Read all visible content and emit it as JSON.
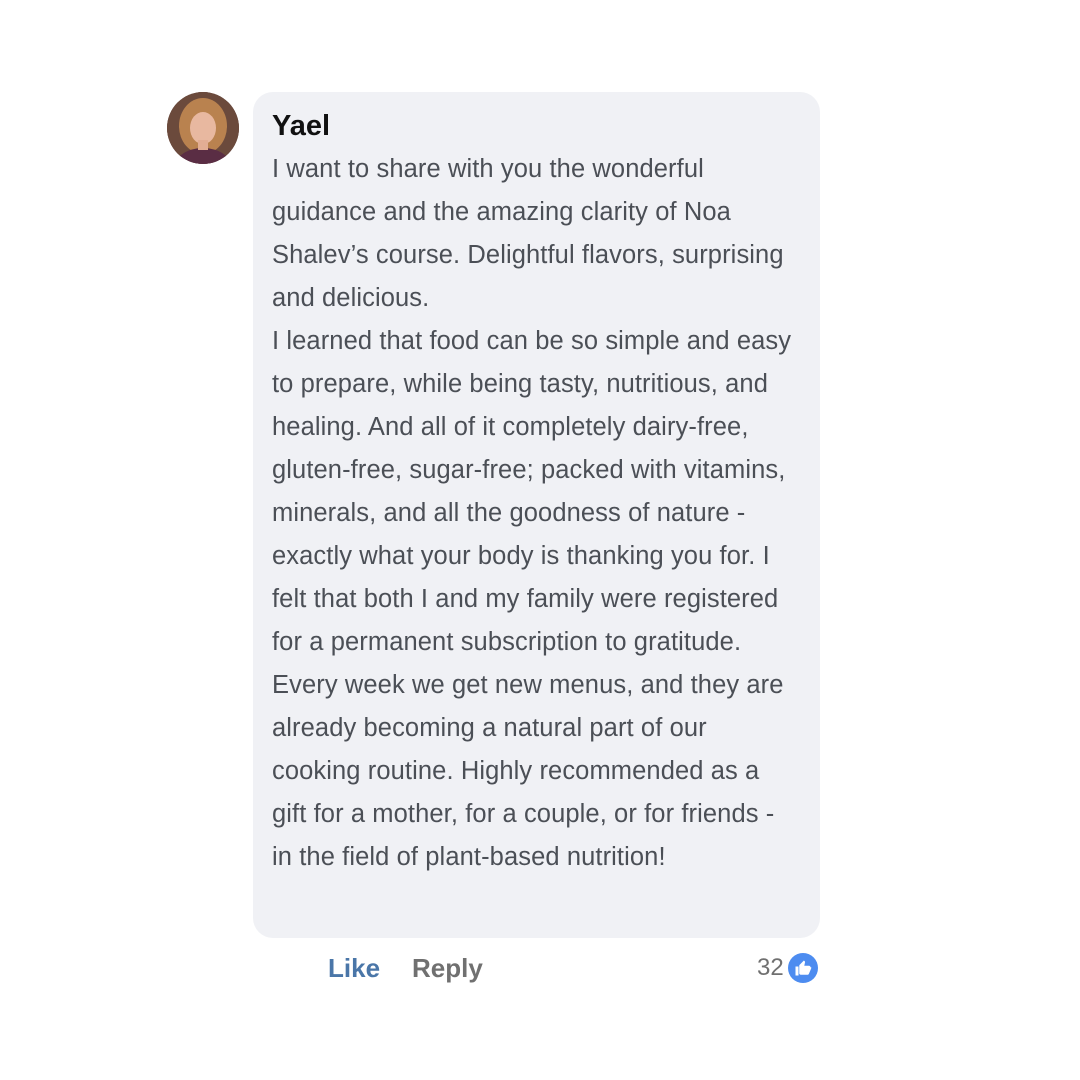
{
  "comment": {
    "author": "Yael",
    "paragraphs": [
      "I want to share with you the wonderful guidance and the amazing clarity of Noa Shalev’s course. Delightful flavors, surprising and delicious.",
      "I learned that food can be so simple and easy to prepare, while being tasty, nutritious, and healing. And all of it completely dairy-free, gluten-free, sugar-free; packed with vitamins, minerals, and all the goodness of nature - exactly what your body is thanking you for. I felt that both I and my family were registered for a permanent subscription to gratitude. Every week we get new menus, and they are already becoming a natural part of our cooking routine. Highly recommended as a gift for a mother, for a couple, or for friends - in the field of plant-based nutrition!"
    ]
  },
  "actions": {
    "like_label": "Like",
    "reply_label": "Reply"
  },
  "reactions": {
    "count": "32",
    "icon": "thumbs-up-icon"
  },
  "colors": {
    "bubble_background": "#f0f1f5",
    "like_link": "#4a76a8",
    "like_badge": "#4d8cf0"
  }
}
